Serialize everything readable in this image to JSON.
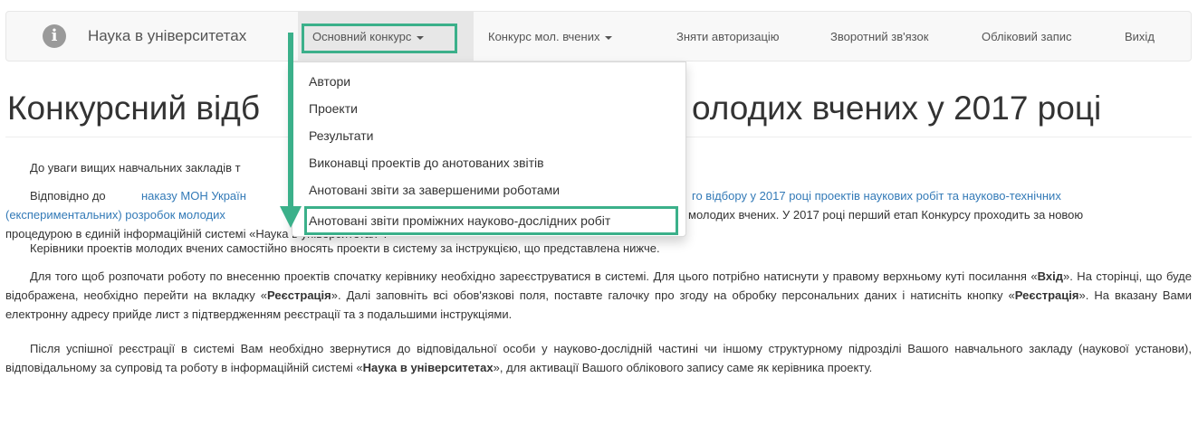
{
  "navbar": {
    "brand": "Наука в університетах",
    "items": [
      {
        "label": "Основний конкурс"
      },
      {
        "label": "Конкурс мол. вчених"
      },
      {
        "label": "Зняти авторизацію"
      },
      {
        "label": "Зворотний зв'язок"
      },
      {
        "label": "Обліковий запис"
      },
      {
        "label": "Вихід"
      }
    ]
  },
  "dropdown": {
    "items": [
      "Автори",
      "Проекти",
      "Результати",
      "Виконавці проектів до анотованих звітів",
      "Анотовані звіти за завершеними роботами",
      "Анотовані звіти проміжних науково-дослідних робіт"
    ]
  },
  "page": {
    "title_left": "Конкурсний відб",
    "title_right": "олодих вчених у 2017 році",
    "p1": "До уваги вищих навчальних закладів т",
    "p2_a": "Відповідно до ",
    "p2_link1": "наказу МОН Україн",
    "p2_gap": "",
    "p2_link2": "го відбору у 2017 році проектів наукових робіт та науково-технічних",
    "p2_line2_link": "(експериментальних) розробок молодих",
    "p2_line2_rest": "молодих вчених. У 2017 році перший етап Конкурсу проходить за новою",
    "p2_line3": "процедурою в єдиній інформаційній системі «Наука в університетах».",
    "p3": "Керівники проектів молодих вчених самостійно вносять проекти в систему за інструкцією, що представлена нижче.",
    "p4_1": "Для того щоб розпочати роботу по внесенню проектів спочатку керівнику необхідно зареєструватися в системі. Для цього потрібно натиснути у правому верхньому куті посилання «",
    "p4_b1": "Вхід",
    "p4_2": "». На сторінці, що буде відображена, необхідно перейти на вкладку «",
    "p4_b2": "Реєстрація",
    "p4_3": "». Далі заповніть всі обов'язкові поля, поставте галочку про згоду на обробку персональних даних і натисніть кнопку «",
    "p4_b3": "Реєстрація",
    "p4_4": "». На вказану Вами електронну адресу прийде лист з підтвердженням реєстрації та з подальшими інструкціями.",
    "p5_1": "Після успішної реєстрації в системі Вам необхідно звернутися до відповідальної особи у науково-дослідній частині чи іншому структурному підрозділі Вашого навчального закладу (наукової установи), відповідальному за супровід та роботу в інформаційній системі «",
    "p5_b1": "Наука в університетах",
    "p5_2": "», для активації Вашого облікового запису саме як керівника проекту."
  },
  "colors": {
    "accent": "#3bb08a",
    "link": "#337ab7"
  }
}
